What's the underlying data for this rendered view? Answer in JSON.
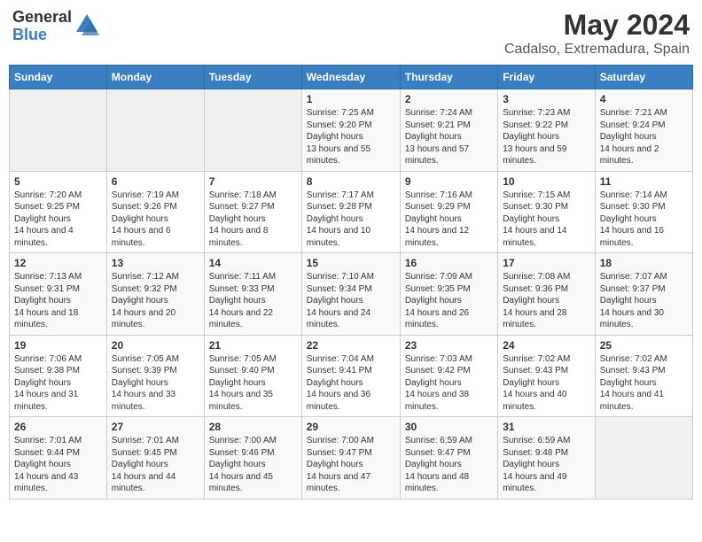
{
  "header": {
    "logo_general": "General",
    "logo_blue": "Blue",
    "month_title": "May 2024",
    "location": "Cadalso, Extremadura, Spain"
  },
  "days_of_week": [
    "Sunday",
    "Monday",
    "Tuesday",
    "Wednesday",
    "Thursday",
    "Friday",
    "Saturday"
  ],
  "weeks": [
    [
      {
        "day": "",
        "empty": true
      },
      {
        "day": "",
        "empty": true
      },
      {
        "day": "",
        "empty": true
      },
      {
        "day": "1",
        "sunrise": "7:25 AM",
        "sunset": "9:20 PM",
        "daylight": "13 hours and 55 minutes."
      },
      {
        "day": "2",
        "sunrise": "7:24 AM",
        "sunset": "9:21 PM",
        "daylight": "13 hours and 57 minutes."
      },
      {
        "day": "3",
        "sunrise": "7:23 AM",
        "sunset": "9:22 PM",
        "daylight": "13 hours and 59 minutes."
      },
      {
        "day": "4",
        "sunrise": "7:21 AM",
        "sunset": "9:24 PM",
        "daylight": "14 hours and 2 minutes."
      }
    ],
    [
      {
        "day": "5",
        "sunrise": "7:20 AM",
        "sunset": "9:25 PM",
        "daylight": "14 hours and 4 minutes."
      },
      {
        "day": "6",
        "sunrise": "7:19 AM",
        "sunset": "9:26 PM",
        "daylight": "14 hours and 6 minutes."
      },
      {
        "day": "7",
        "sunrise": "7:18 AM",
        "sunset": "9:27 PM",
        "daylight": "14 hours and 8 minutes."
      },
      {
        "day": "8",
        "sunrise": "7:17 AM",
        "sunset": "9:28 PM",
        "daylight": "14 hours and 10 minutes."
      },
      {
        "day": "9",
        "sunrise": "7:16 AM",
        "sunset": "9:29 PM",
        "daylight": "14 hours and 12 minutes."
      },
      {
        "day": "10",
        "sunrise": "7:15 AM",
        "sunset": "9:30 PM",
        "daylight": "14 hours and 14 minutes."
      },
      {
        "day": "11",
        "sunrise": "7:14 AM",
        "sunset": "9:30 PM",
        "daylight": "14 hours and 16 minutes."
      }
    ],
    [
      {
        "day": "12",
        "sunrise": "7:13 AM",
        "sunset": "9:31 PM",
        "daylight": "14 hours and 18 minutes."
      },
      {
        "day": "13",
        "sunrise": "7:12 AM",
        "sunset": "9:32 PM",
        "daylight": "14 hours and 20 minutes."
      },
      {
        "day": "14",
        "sunrise": "7:11 AM",
        "sunset": "9:33 PM",
        "daylight": "14 hours and 22 minutes."
      },
      {
        "day": "15",
        "sunrise": "7:10 AM",
        "sunset": "9:34 PM",
        "daylight": "14 hours and 24 minutes."
      },
      {
        "day": "16",
        "sunrise": "7:09 AM",
        "sunset": "9:35 PM",
        "daylight": "14 hours and 26 minutes."
      },
      {
        "day": "17",
        "sunrise": "7:08 AM",
        "sunset": "9:36 PM",
        "daylight": "14 hours and 28 minutes."
      },
      {
        "day": "18",
        "sunrise": "7:07 AM",
        "sunset": "9:37 PM",
        "daylight": "14 hours and 30 minutes."
      }
    ],
    [
      {
        "day": "19",
        "sunrise": "7:06 AM",
        "sunset": "9:38 PM",
        "daylight": "14 hours and 31 minutes."
      },
      {
        "day": "20",
        "sunrise": "7:05 AM",
        "sunset": "9:39 PM",
        "daylight": "14 hours and 33 minutes."
      },
      {
        "day": "21",
        "sunrise": "7:05 AM",
        "sunset": "9:40 PM",
        "daylight": "14 hours and 35 minutes."
      },
      {
        "day": "22",
        "sunrise": "7:04 AM",
        "sunset": "9:41 PM",
        "daylight": "14 hours and 36 minutes."
      },
      {
        "day": "23",
        "sunrise": "7:03 AM",
        "sunset": "9:42 PM",
        "daylight": "14 hours and 38 minutes."
      },
      {
        "day": "24",
        "sunrise": "7:02 AM",
        "sunset": "9:43 PM",
        "daylight": "14 hours and 40 minutes."
      },
      {
        "day": "25",
        "sunrise": "7:02 AM",
        "sunset": "9:43 PM",
        "daylight": "14 hours and 41 minutes."
      }
    ],
    [
      {
        "day": "26",
        "sunrise": "7:01 AM",
        "sunset": "9:44 PM",
        "daylight": "14 hours and 43 minutes."
      },
      {
        "day": "27",
        "sunrise": "7:01 AM",
        "sunset": "9:45 PM",
        "daylight": "14 hours and 44 minutes."
      },
      {
        "day": "28",
        "sunrise": "7:00 AM",
        "sunset": "9:46 PM",
        "daylight": "14 hours and 45 minutes."
      },
      {
        "day": "29",
        "sunrise": "7:00 AM",
        "sunset": "9:47 PM",
        "daylight": "14 hours and 47 minutes."
      },
      {
        "day": "30",
        "sunrise": "6:59 AM",
        "sunset": "9:47 PM",
        "daylight": "14 hours and 48 minutes."
      },
      {
        "day": "31",
        "sunrise": "6:59 AM",
        "sunset": "9:48 PM",
        "daylight": "14 hours and 49 minutes."
      },
      {
        "day": "",
        "empty": true
      }
    ]
  ],
  "labels": {
    "sunrise": "Sunrise:",
    "sunset": "Sunset:",
    "daylight": "Daylight hours"
  }
}
